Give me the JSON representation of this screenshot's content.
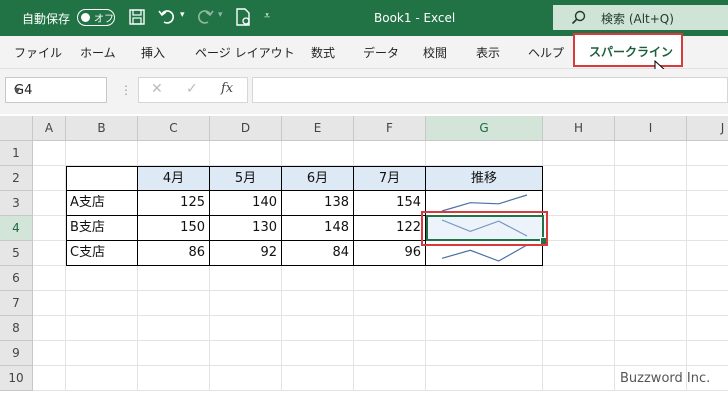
{
  "titlebar": {
    "autosave_label": "自動保存",
    "toggle_text": "オフ",
    "title": "Book1  -  Excel",
    "search_label": "検索 (Alt+Q)"
  },
  "ribbon": {
    "tabs": [
      "ファイル",
      "ホーム",
      "挿入",
      "ページ レイアウト",
      "数式",
      "データ",
      "校閲",
      "表示",
      "ヘルプ"
    ],
    "active_tab": "スパークライン"
  },
  "formula_bar": {
    "name_box": "G4",
    "fx": "fx",
    "value": ""
  },
  "sheet": {
    "columns": [
      "A",
      "B",
      "C",
      "D",
      "E",
      "F",
      "G",
      "H",
      "I",
      "J"
    ],
    "rows": [
      "1",
      "2",
      "3",
      "4",
      "5",
      "6",
      "7",
      "8",
      "9",
      "10"
    ],
    "selected_cell": "G4",
    "table": {
      "headers": [
        "4月",
        "5月",
        "6月",
        "7月",
        "推移"
      ],
      "rows": [
        {
          "name": "A支店",
          "values": [
            125,
            140,
            138,
            154
          ]
        },
        {
          "name": "B支店",
          "values": [
            150,
            130,
            148,
            122
          ]
        },
        {
          "name": "C支店",
          "values": [
            86,
            92,
            84,
            96
          ]
        }
      ]
    }
  },
  "watermark": "Buzzword Inc.",
  "colors": {
    "excel_green": "#217346",
    "highlight_red": "#d83b3b",
    "header_blue": "#dde9f5",
    "sparkline": "#4a6fa5"
  }
}
